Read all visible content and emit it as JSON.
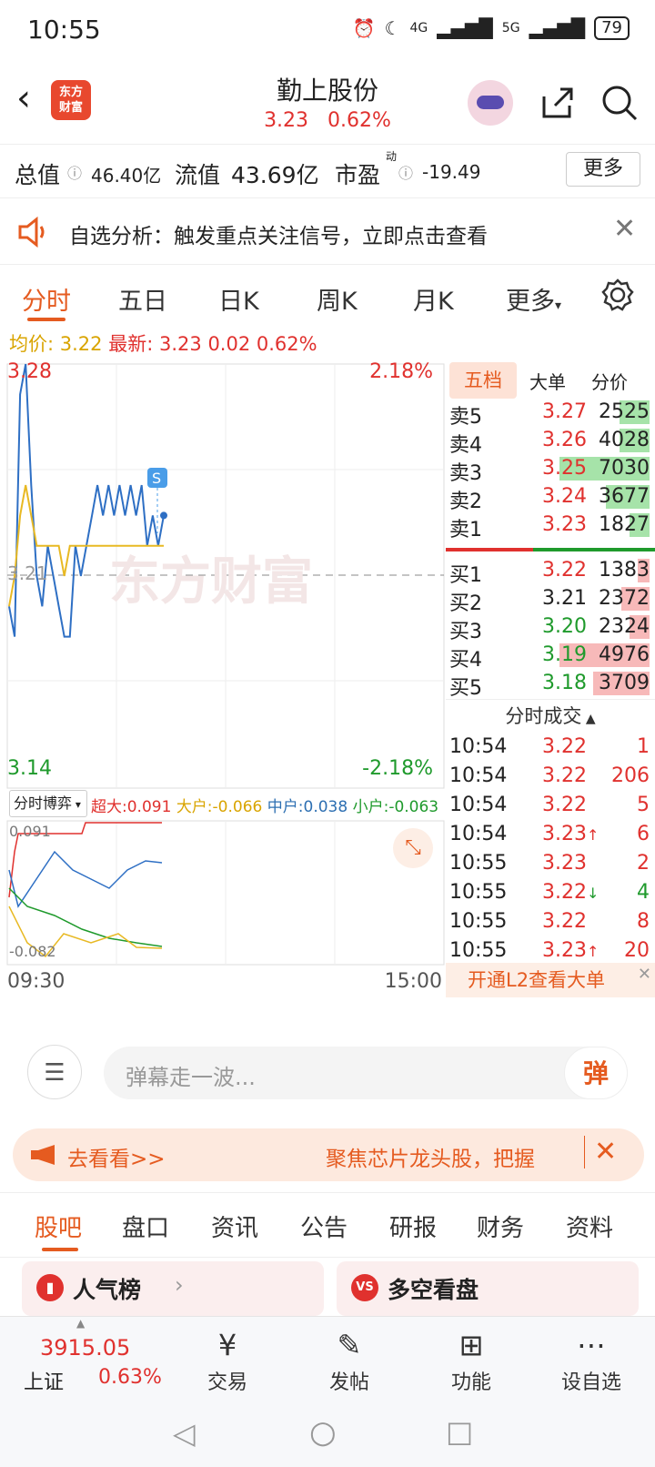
{
  "status_bar": {
    "time": "10:55",
    "net1": "4G",
    "net2": "5G",
    "battery": "79"
  },
  "header": {
    "logo_text": "东方\n财富",
    "stock_name": "勤上股份",
    "price": "3.23",
    "change_pct": "0.62%"
  },
  "metrics": {
    "total_label": "总值",
    "total_value": "46.40亿",
    "float_label": "流值",
    "float_value": "43.69亿",
    "pe_label": "市盈",
    "pe_sup": "动",
    "pe_value": "-19.49",
    "more_label": "更多"
  },
  "notice": {
    "text": "自选分析：触发重点关注信号，立即点击查看"
  },
  "tabs": [
    "分时",
    "五日",
    "日K",
    "周K",
    "月K",
    "更多"
  ],
  "info": {
    "avg_label": "均价:",
    "avg_value": "3.22",
    "latest_label": "最新:",
    "latest_value": "3.23",
    "chg": "0.02",
    "chg_pct": "0.62%"
  },
  "chart": {
    "y_top": "3.28",
    "y_bottom": "3.14",
    "y_mid": "3.21",
    "pct_top": "2.18%",
    "pct_bottom": "-2.18%",
    "watermark": "东方财富",
    "marker": "S",
    "time_start": "09:30",
    "time_end": "15:00",
    "flow_selector": "分时博弈",
    "flow_big_label": "超大:",
    "flow_big": "0.091",
    "flow_large_label": "大户:",
    "flow_large": "-0.066",
    "flow_mid_label": "中户:",
    "flow_mid": "0.038",
    "flow_small_label": "小户:",
    "flow_small": "-0.063",
    "flow_max": "0.091",
    "flow_min": "-0.082"
  },
  "chart_data": {
    "type": "line",
    "x_range": [
      "09:30",
      "15:00"
    ],
    "ylim": [
      3.14,
      3.28
    ],
    "baseline": 3.21,
    "series": [
      {
        "values": [
          3.2,
          3.19,
          3.27,
          3.28,
          3.24,
          3.21,
          3.2,
          3.22,
          3.21,
          3.2,
          3.19,
          3.19,
          3.22,
          3.21,
          3.22,
          3.23,
          3.24,
          3.23,
          3.24,
          3.23,
          3.24,
          3.23,
          3.24,
          3.23,
          3.24,
          3.22,
          3.23,
          3.22,
          3.23
        ]
      },
      {
        "values": [
          3.2,
          3.21,
          3.23,
          3.24,
          3.23,
          3.22,
          3.22,
          3.22,
          3.22,
          3.22,
          3.21,
          3.22,
          3.22,
          3.22,
          3.22,
          3.22,
          3.22,
          3.22,
          3.22,
          3.22,
          3.22,
          3.22,
          3.22,
          3.22,
          3.22,
          3.22,
          3.22,
          3.22,
          3.22
        ]
      }
    ]
  },
  "book_tabs": [
    "五档",
    "大单",
    "分价"
  ],
  "asks": [
    {
      "label": "卖5",
      "price": "3.27",
      "vol": "2525",
      "bar": 0.15
    },
    {
      "label": "卖4",
      "price": "3.26",
      "vol": "4028",
      "bar": 0.15
    },
    {
      "label": "卖3",
      "price": "3.25",
      "vol": "7030",
      "bar": 0.45
    },
    {
      "label": "卖2",
      "price": "3.24",
      "vol": "3677",
      "bar": 0.22
    },
    {
      "label": "卖1",
      "price": "3.23",
      "vol": "1827",
      "bar": 0.1
    }
  ],
  "bids": [
    {
      "label": "买1",
      "price": "3.22",
      "vol": "1383",
      "bar": 0.06
    },
    {
      "label": "买2",
      "price": "3.21",
      "vol": "2372",
      "bar": 0.14
    },
    {
      "label": "买3",
      "price": "3.20",
      "vol": "2324",
      "bar": 0.1
    },
    {
      "label": "买4",
      "price": "3.19",
      "vol": "4976",
      "bar": 0.45
    },
    {
      "label": "买5",
      "price": "3.18",
      "vol": "3709",
      "bar": 0.28
    }
  ],
  "trades_title": "分时成交",
  "trades": [
    {
      "time": "10:54",
      "price": "3.22",
      "dir": "",
      "vol": "1"
    },
    {
      "time": "10:54",
      "price": "3.22",
      "dir": "",
      "vol": "206"
    },
    {
      "time": "10:54",
      "price": "3.22",
      "dir": "",
      "vol": "5"
    },
    {
      "time": "10:54",
      "price": "3.23",
      "dir": "↑",
      "vol": "6"
    },
    {
      "time": "10:55",
      "price": "3.23",
      "dir": "",
      "vol": "2"
    },
    {
      "time": "10:55",
      "price": "3.22",
      "dir": "↓",
      "vol": "4"
    },
    {
      "time": "10:55",
      "price": "3.22",
      "dir": "",
      "vol": "8"
    },
    {
      "time": "10:55",
      "price": "3.23",
      "dir": "↑",
      "vol": "20"
    }
  ],
  "l2_banner": "开通L2查看大单",
  "danmu": {
    "placeholder": "弹幕走一波...",
    "send": "弹"
  },
  "promo": {
    "left": "去看看>>",
    "right": "聚焦芯片龙头股，把握"
  },
  "subtabs": [
    "股吧",
    "盘口",
    "资讯",
    "公告",
    "研报",
    "财务",
    "资料"
  ],
  "cards": [
    {
      "title": "人气榜"
    },
    {
      "title": "多空看盘"
    }
  ],
  "index": {
    "value": "3915.05",
    "name": "上证",
    "pct": "0.63%"
  },
  "bottom_nav": [
    "交易",
    "发帖",
    "功能",
    "设自选"
  ]
}
